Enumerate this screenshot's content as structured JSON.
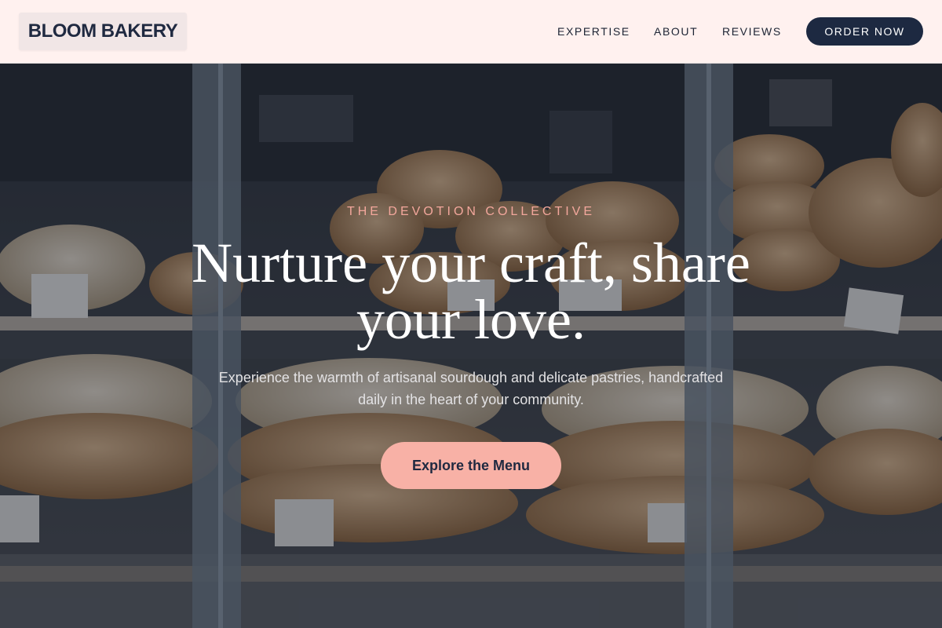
{
  "header": {
    "brand": "BLOOM BAKERY",
    "nav": [
      {
        "label": "EXPERTISE"
      },
      {
        "label": "ABOUT"
      },
      {
        "label": "REVIEWS"
      }
    ],
    "order_label": "ORDER NOW"
  },
  "hero": {
    "eyebrow": "THE DEVOTION COLLECTIVE",
    "headline_line1": "Nurture your craft, share",
    "headline_line2": "your love.",
    "subtitle": "Experience the warmth of artisanal sourdough and delicate pastries, handcrafted daily in the heart of your community.",
    "cta_label": "Explore the Menu",
    "background_description_icon": "bakery-display-photo"
  },
  "colors": {
    "header_bg": "#fff1ef",
    "brand_text": "#1f2940",
    "order_button_bg": "#1d2941",
    "accent_pink": "#f8b1a6",
    "eyebrow": "#f3a79c"
  }
}
